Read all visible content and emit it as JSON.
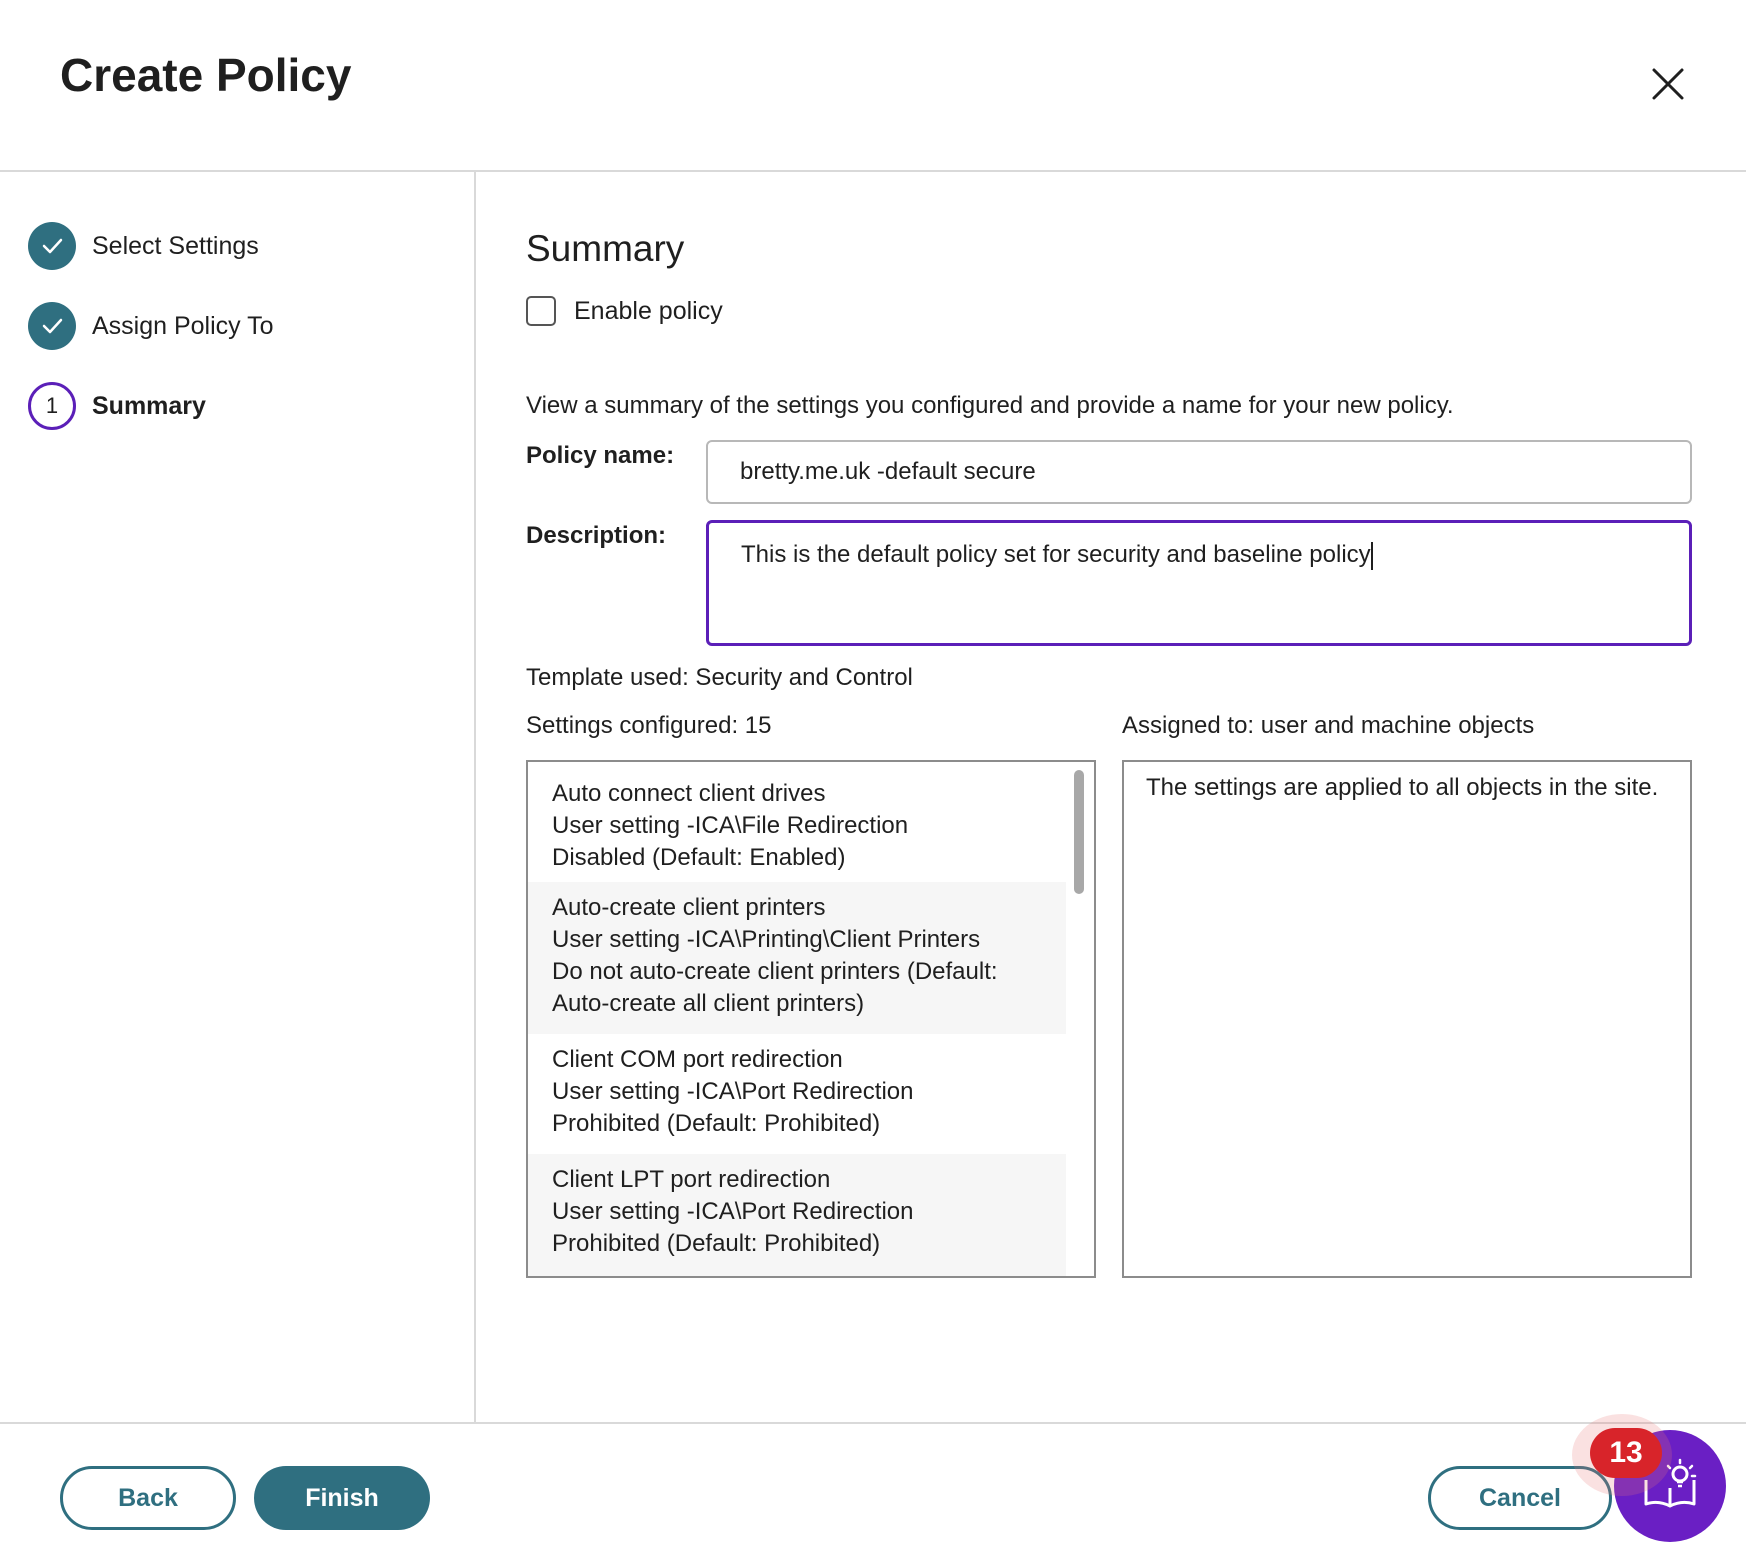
{
  "dialog": {
    "title": "Create Policy",
    "close_icon": "close-icon"
  },
  "steps": [
    {
      "label": "Select Settings",
      "state": "completed",
      "icon": "check-icon"
    },
    {
      "label": "Assign Policy To",
      "state": "completed",
      "icon": "check-icon"
    },
    {
      "label": "Summary",
      "state": "current",
      "number": "1"
    }
  ],
  "summary": {
    "heading": "Summary",
    "enable_policy_label": "Enable policy",
    "enable_policy_checked": false,
    "intro": "View a summary of the settings you configured and provide a name for your new policy.",
    "policy_name_label": "Policy name:",
    "policy_name_value": "bretty.me.uk -default secure",
    "description_label": "Description:",
    "description_value": "This is the default policy set for security and baseline policy",
    "template_used": "Template used: Security and Control",
    "settings_configured": "Settings configured: 15",
    "assigned_to": "Assigned to: user and machine objects",
    "settings_list": [
      {
        "lines": [
          "Auto connect client drives",
          "User setting -ICA\\File Redirection",
          "Disabled (Default: Enabled)"
        ]
      },
      {
        "lines": [
          "Auto-create client printers",
          "User setting -ICA\\Printing\\Client Printers",
          "Do not auto-create client printers (Default:",
          "Auto-create all client printers)"
        ]
      },
      {
        "lines": [
          "Client COM port redirection",
          "User setting -ICA\\Port Redirection",
          "Prohibited (Default: Prohibited)"
        ]
      },
      {
        "lines": [
          "Client LPT port redirection",
          "User setting -ICA\\Port Redirection",
          "Prohibited (Default: Prohibited)"
        ]
      }
    ],
    "assigned_detail": "The settings are applied to all objects in the site."
  },
  "footer": {
    "back_label": "Back",
    "finish_label": "Finish",
    "cancel_label": "Cancel"
  },
  "help_widget": {
    "icon": "lightbulb-book-icon",
    "badge_count": "13",
    "badge_color": "#d8242a",
    "button_color": "#6a1fc4"
  },
  "colors": {
    "accent_teal": "#2f6f80",
    "focus_purple": "#5b1fb8"
  }
}
